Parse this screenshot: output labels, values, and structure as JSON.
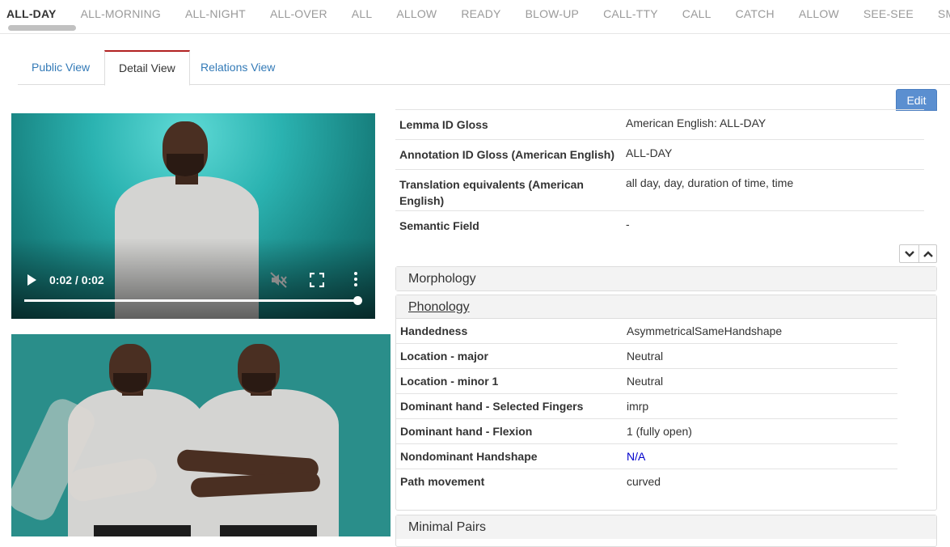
{
  "sign_strip": {
    "items": [
      "ALL-DAY",
      "ALL-MORNING",
      "ALL-NIGHT",
      "ALL-OVER",
      "ALL",
      "ALLOW",
      "READY",
      "BLOW-UP",
      "CALL-TTY",
      "CALL",
      "CATCH",
      "ALLOW",
      "SEE-SEE",
      "SMALL"
    ],
    "active_index": 0
  },
  "tabs": [
    "Public View",
    "Detail View",
    "Relations View"
  ],
  "active_tab": "Detail View",
  "edit_label": "Edit",
  "video": {
    "time": "0:02 / 0:02",
    "progress": 1.0
  },
  "lemma": [
    {
      "key": "Lemma ID Gloss",
      "value": "American English: ALL-DAY"
    },
    {
      "key": "Annotation ID Gloss (American English)",
      "value": "ALL-DAY"
    },
    {
      "key": "Translation equivalents (American English)",
      "value": "all day, day, duration of time, time"
    },
    {
      "key": "Semantic Field",
      "value": "-"
    }
  ],
  "panels": {
    "morphology": "Morphology",
    "phonology": "Phonology",
    "minimal_pairs": "Minimal Pairs"
  },
  "phonology": [
    {
      "key": "Handedness",
      "value": "AsymmetricalSameHandshape"
    },
    {
      "key": "Location - major",
      "value": "Neutral"
    },
    {
      "key": "Location - minor 1",
      "value": "Neutral"
    },
    {
      "key": "Dominant hand - Selected Fingers",
      "value": "imrp"
    },
    {
      "key": "Dominant hand - Flexion",
      "value": "1 (fully open)"
    },
    {
      "key": "Nondominant Handshape",
      "value": "N/A"
    },
    {
      "key": "Path movement",
      "value": "curved"
    }
  ],
  "colors": {
    "accent": "#337ab7",
    "edit": "#5b8fd0",
    "video_bg": "#2bb3b1",
    "link": "#0000cc"
  }
}
